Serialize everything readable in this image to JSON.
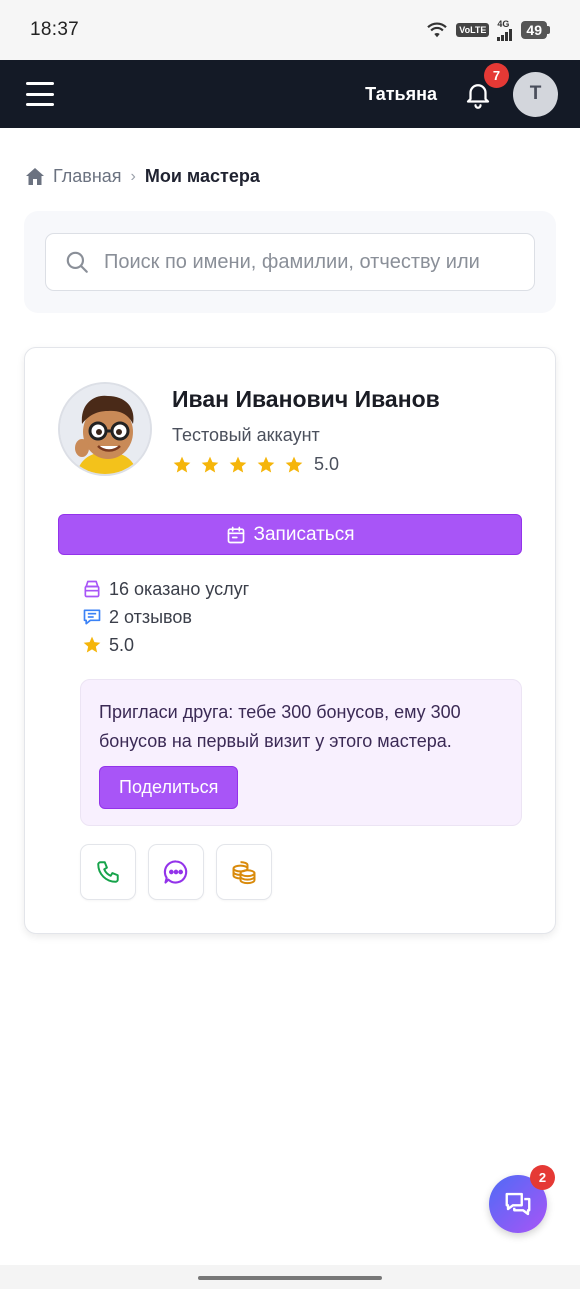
{
  "status_bar": {
    "time": "18:37",
    "volte": "VoLTE",
    "network": "4G",
    "battery": "49"
  },
  "header": {
    "user_name": "Татьяна",
    "notifications_count": "7",
    "avatar_letter": "Т"
  },
  "breadcrumb": {
    "home": "Главная",
    "separator": "›",
    "current": "Мои мастера"
  },
  "search": {
    "placeholder": "Поиск по имени, фамилии, отчеству или",
    "value": ""
  },
  "master": {
    "name": "Иван Иванович Иванов",
    "subtitle": "Тестовый аккаунт",
    "stars": 5,
    "rating": "5.0",
    "book_label": "Записаться",
    "stats": {
      "services": "16 оказано услуг",
      "reviews": "2 отзывов",
      "rating": "5.0"
    },
    "invite": {
      "text": "Пригласи друга: тебе 300 бонусов, ему 300 бонусов на первый визит у этого мастера.",
      "share_label": "Поделиться"
    },
    "actions": [
      "phone-icon",
      "chat-icon",
      "coins-icon"
    ]
  },
  "chat_fab": {
    "badge": "2"
  },
  "colors": {
    "header_bg": "#141a26",
    "accent": "#a855f7",
    "star": "#f5b50a",
    "badge": "#e53935"
  }
}
